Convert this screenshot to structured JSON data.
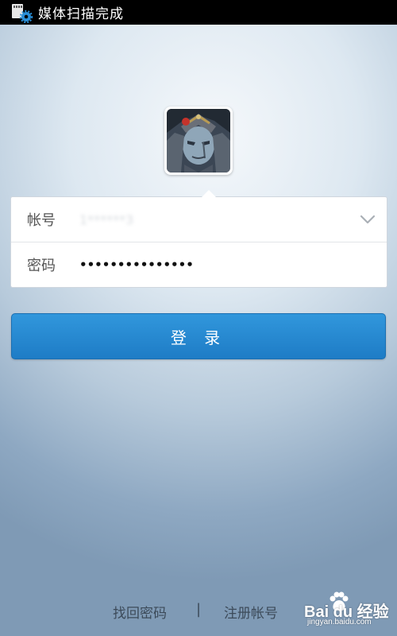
{
  "status_bar": {
    "icon": "media-scan-settings-icon",
    "text": "媒体扫描完成",
    "background": "#000000"
  },
  "avatar": {
    "icon": "user-avatar"
  },
  "login_form": {
    "account_label": "帐号",
    "account_value": "1******3",
    "password_label": "密码",
    "password_value": "•••••••••••••••",
    "dropdown_icon": "chevron-down-icon"
  },
  "login_button": {
    "label": "登 录",
    "color": "#2589d2"
  },
  "footer": {
    "forgot_password": "找回密码",
    "separator": "|",
    "register": "注册帐号"
  },
  "watermark": {
    "brand": "Bai du 经验",
    "url": "jingyan.baidu.com"
  }
}
